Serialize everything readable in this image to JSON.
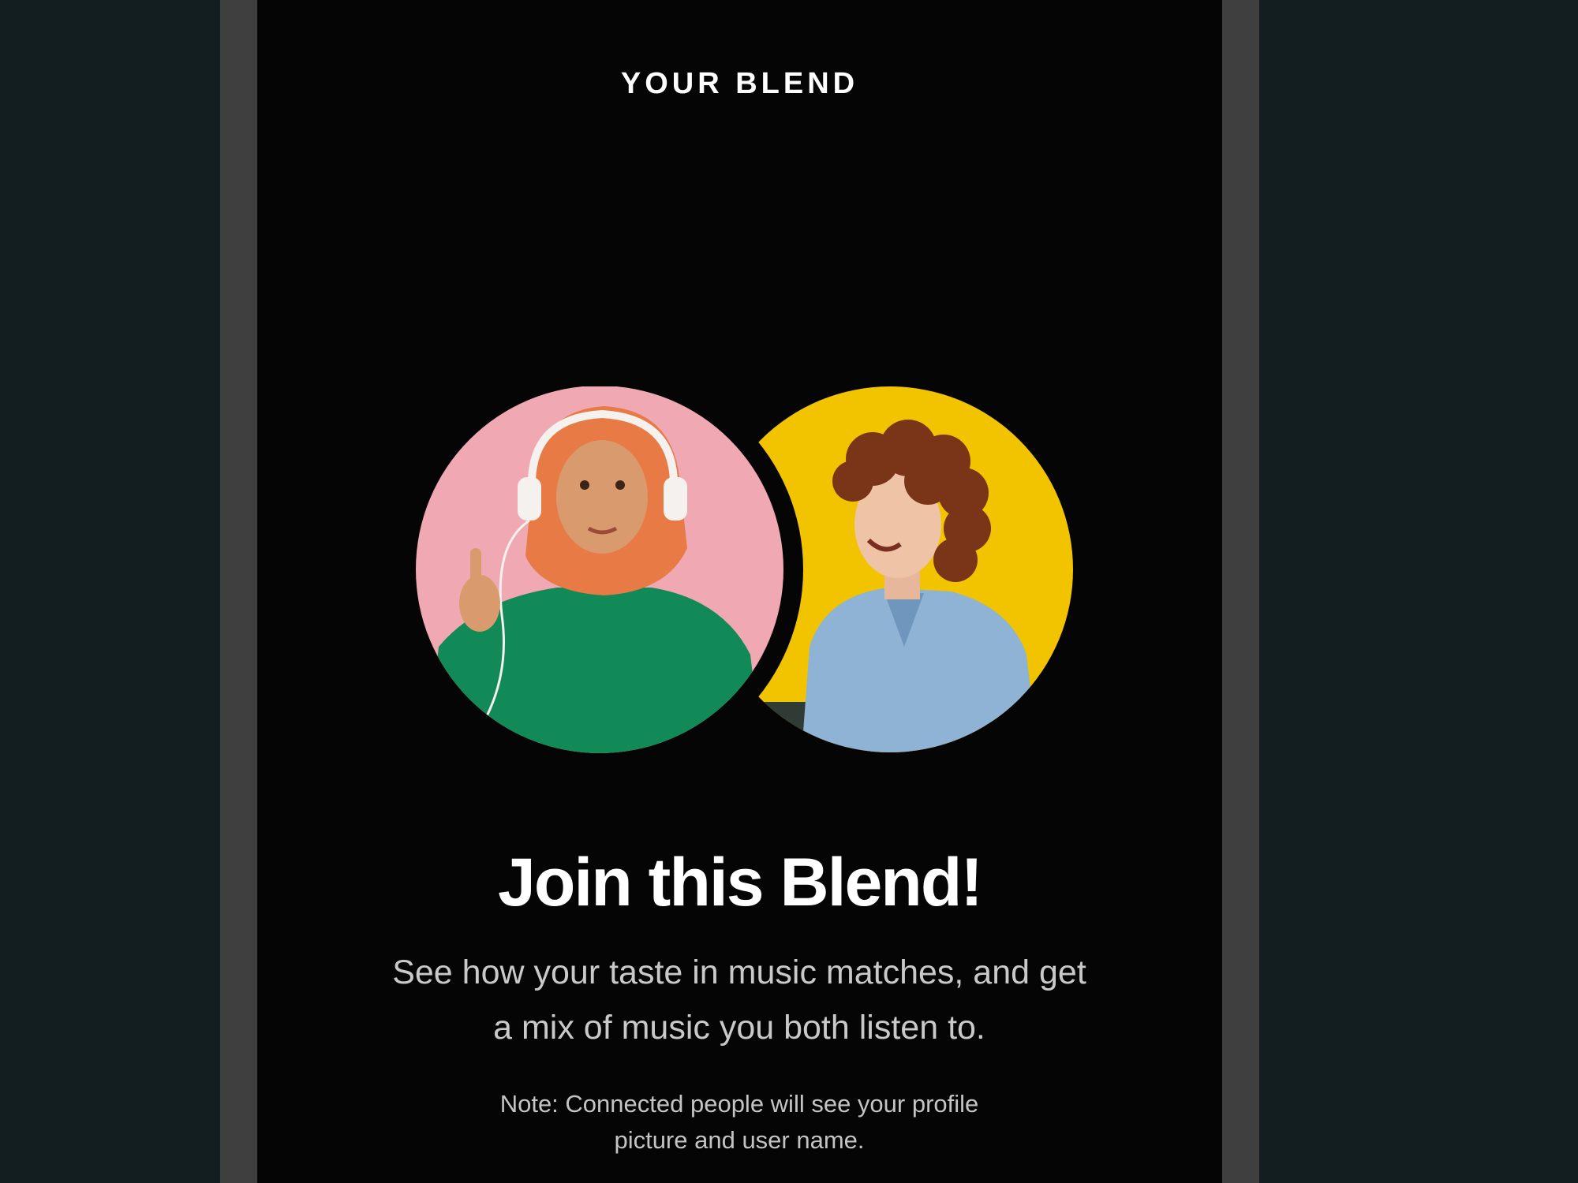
{
  "screen": {
    "header_title": "YOUR BLEND",
    "headline": "Join this Blend!",
    "description": "See how your taste in music matches, and get a mix of music you both listen to.",
    "note": "Note: Connected people will see your profile picture and user name."
  },
  "avatars": [
    {
      "icon": "person-photo-icon",
      "background_color": "#f0a9b3"
    },
    {
      "icon": "person-photo-icon",
      "background_color": "#f2c400"
    }
  ],
  "colors": {
    "page_background": "#131e20",
    "device_frame": "#3f3f3f",
    "screen_background": "#050505",
    "text_primary": "#ffffff",
    "text_secondary": "#c9c9c9"
  }
}
